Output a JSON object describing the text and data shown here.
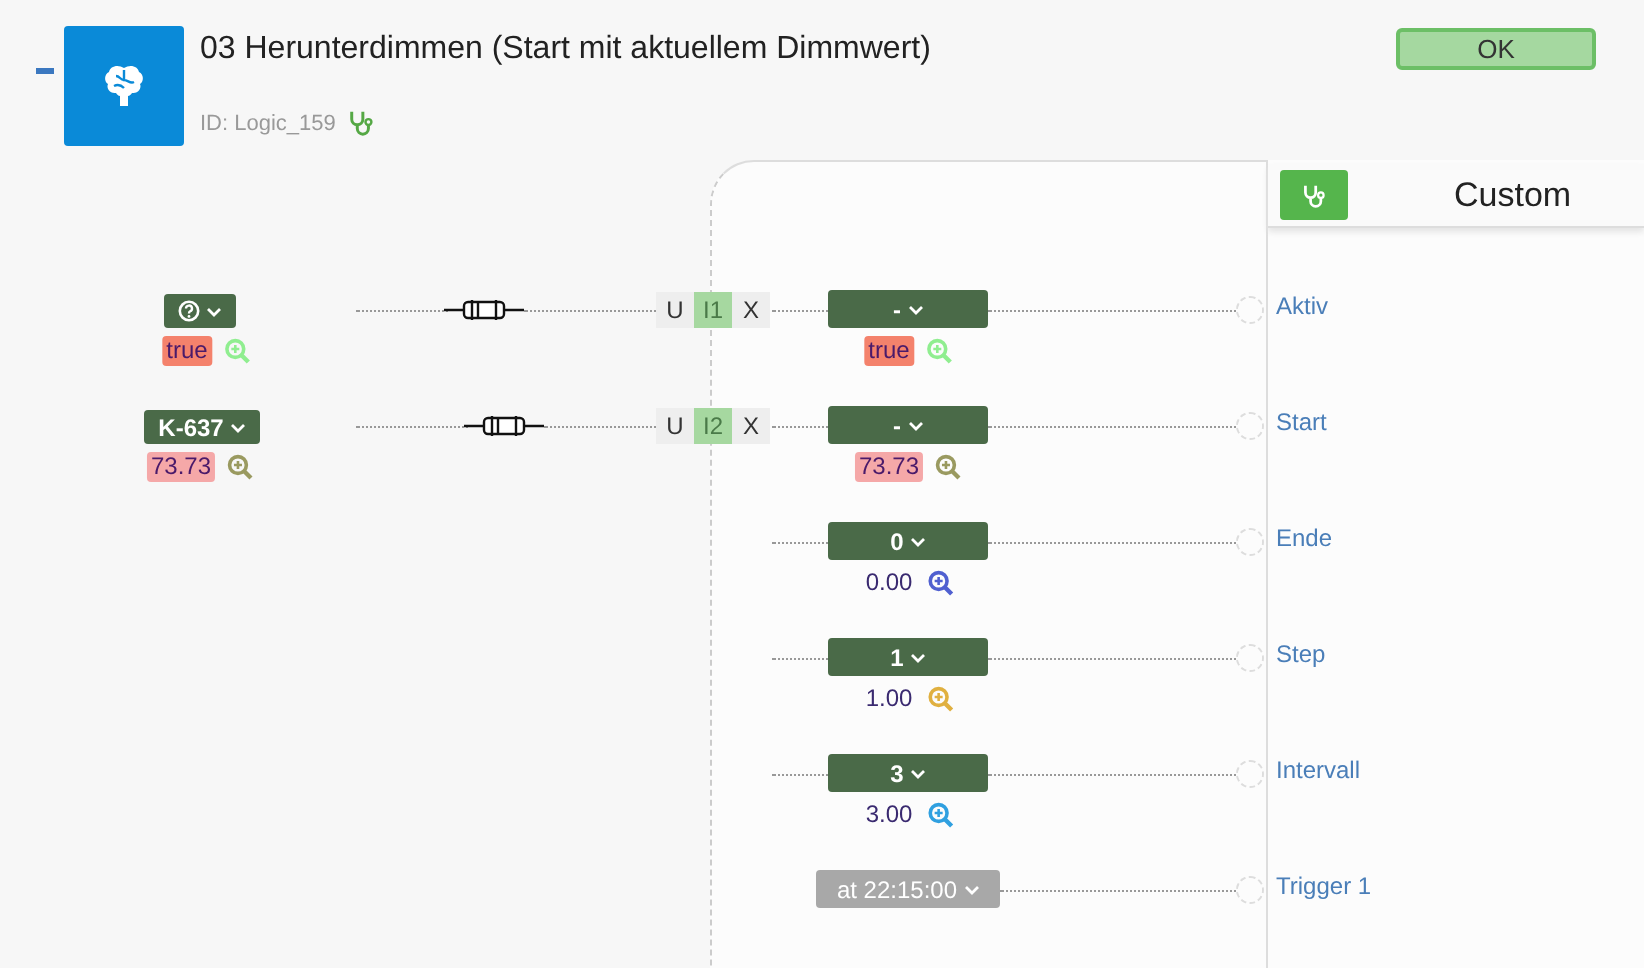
{
  "block": {
    "title": "03 Herunterdimmen (Start mit aktuellem Dimmwert)",
    "id": "ID: Logic_159",
    "status": "OK"
  },
  "panel": {
    "title": "Custom"
  },
  "inputs": [
    {
      "kind": "linked",
      "source": {
        "kind": "unknown",
        "value": {
          "kind": "alert",
          "text": "true",
          "color": "#90ee90"
        }
      },
      "connector": {
        "u": "U",
        "port": "I1",
        "x": "X"
      },
      "selector": "-",
      "value": {
        "kind": "alert",
        "text": "true",
        "color": "#90ee90"
      },
      "name": "Aktiv"
    },
    {
      "kind": "linked",
      "source": {
        "kind": "object",
        "label": "K-637",
        "value": {
          "kind": "soft",
          "text": "73.73",
          "color": "#9a9a60"
        }
      },
      "connector": {
        "u": "U",
        "port": "I2",
        "x": "X"
      },
      "selector": "-",
      "value": {
        "kind": "soft",
        "text": "73.73",
        "color": "#9a9a60"
      },
      "name": "Start"
    },
    {
      "kind": "constant",
      "selector": "0",
      "value": {
        "kind": "plain",
        "text": "0.00",
        "color": "#5060d0"
      },
      "name": "Ende"
    },
    {
      "kind": "constant",
      "selector": "1",
      "value": {
        "kind": "plain",
        "text": "1.00",
        "color": "#e0b040"
      },
      "name": "Step"
    },
    {
      "kind": "constant",
      "selector": "3",
      "value": {
        "kind": "plain",
        "text": "3.00",
        "color": "#30a0e0"
      },
      "name": "Intervall"
    },
    {
      "kind": "timer",
      "selector": "at 22:15:00",
      "name": "Trigger 1"
    }
  ]
}
